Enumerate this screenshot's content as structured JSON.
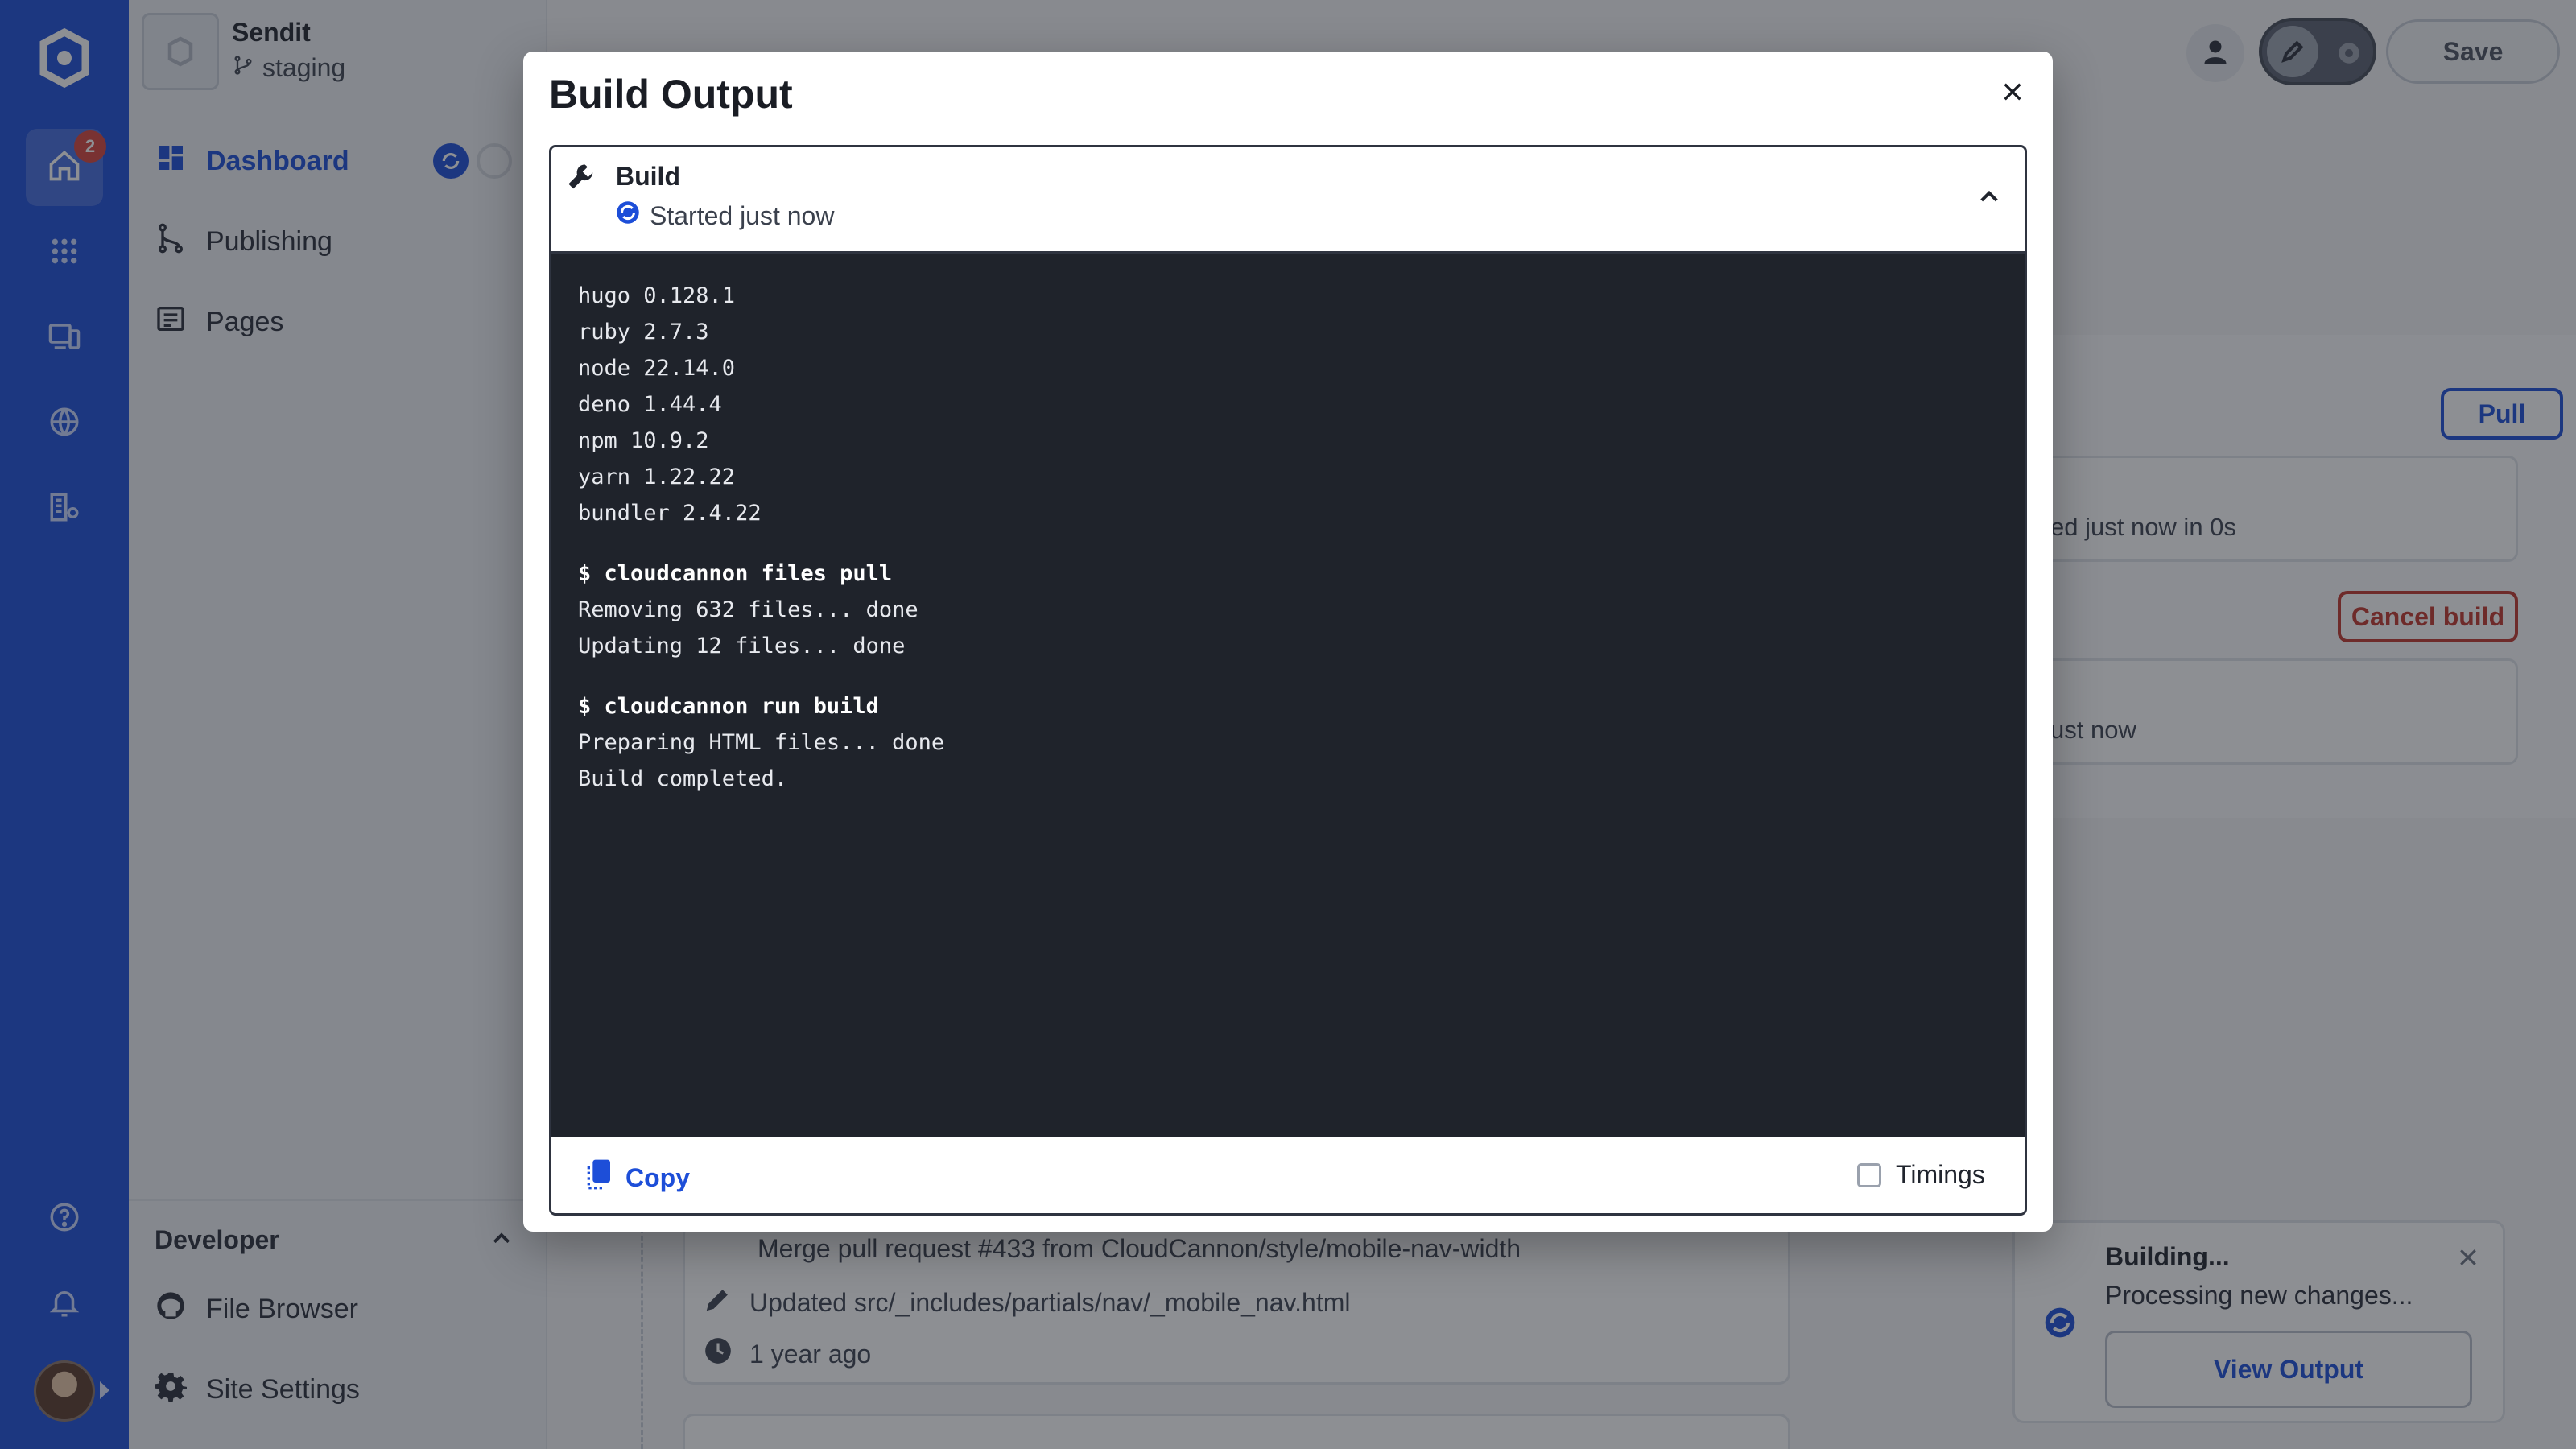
{
  "site": {
    "name": "Sendit",
    "branch": "staging"
  },
  "rail": {
    "badge_count": "2"
  },
  "sidebar": {
    "items": [
      {
        "label": "Dashboard"
      },
      {
        "label": "Publishing"
      },
      {
        "label": "Pages"
      }
    ],
    "developer": {
      "title": "Developer",
      "items": [
        {
          "label": "File Browser"
        },
        {
          "label": "Site Settings"
        }
      ]
    }
  },
  "topbar": {
    "save_label": "Save"
  },
  "background": {
    "pull_label": "Pull",
    "cancel_label": "Cancel build",
    "box1_text": "ed just now in 0s",
    "box2_text": "ust now",
    "commit": {
      "message": "Merge pull request #433 from CloudCannon/style/mobile-nav-width",
      "file": "Updated src/_includes/partials/nav/_mobile_nav.html",
      "time": "1 year ago"
    }
  },
  "toast": {
    "title": "Building...",
    "message": "Processing new changes...",
    "button": "View Output"
  },
  "modal": {
    "title": "Build Output",
    "section": {
      "title": "Build",
      "status": "Started just now"
    },
    "console_blocks": [
      {
        "lines": [
          "hugo 0.128.1",
          "ruby 2.7.3",
          "node 22.14.0",
          "deno 1.44.4",
          "npm 10.9.2",
          "yarn 1.22.22",
          "bundler 2.4.22"
        ]
      },
      {
        "command": "$ cloudcannon files pull",
        "lines": [
          "Removing 632 files... done",
          "Updating 12 files... done"
        ]
      },
      {
        "command": "$ cloudcannon run build",
        "lines": [
          "Preparing HTML files... done",
          "Build completed."
        ]
      }
    ],
    "copy_label": "Copy",
    "timings_label": "Timings"
  },
  "colors": {
    "brand": "#1d4ed8",
    "danger": "#c0362c",
    "console_bg": "#1f232b"
  }
}
